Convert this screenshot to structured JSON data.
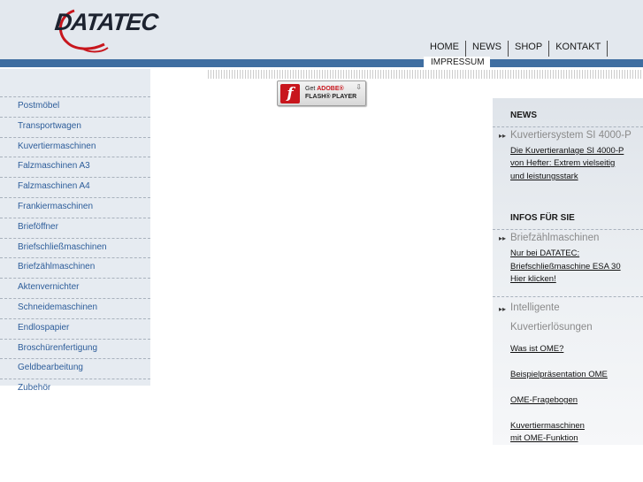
{
  "colors": {
    "accent_bar": "#3f6ea1",
    "header_bg": "#e3e8ee",
    "sidebar_bg": "#e6ebf1",
    "link": "#2d5d9a"
  },
  "logo": {
    "text": "DATATEC"
  },
  "topnav": {
    "items": [
      "HOME",
      "NEWS",
      "SHOP",
      "KONTAKT"
    ],
    "impressum": "IMPRESSUM"
  },
  "sidebar": {
    "items": [
      "Postmöbel",
      "Transportwagen",
      "Kuvertiermaschinen",
      "Falzmaschinen A3",
      "Falzmaschinen A4",
      "Frankiermaschinen",
      "Brieföffner",
      "Briefschließmaschinen",
      "Briefzählmaschinen",
      "Aktenvernichter",
      "Schneidemaschinen",
      "Endlospapier",
      "Broschürenfertigung",
      "Geldbearbeitung",
      "Zubehör"
    ]
  },
  "flash": {
    "get": "Get",
    "adobe": "ADOBE®",
    "product": "FLASH® PLAYER",
    "icon": "flash-logo-icon",
    "download_icon": "download-arrow-icon"
  },
  "right": {
    "news_heading": "NEWS",
    "news_sub": "Kuvertiersystem SI 4000-P",
    "news_link": [
      "Die Kuvertieranlage SI 4000-P",
      "von Hefter: Extrem vielseitig",
      "und leistungsstark"
    ],
    "infos_heading": "INFOS FÜR SIE",
    "infos_sub1": "Briefzählmaschinen",
    "infos_link1": [
      "Nur bei DATATEC:",
      "Briefschließmaschine ESA 30",
      "Hier klicken!"
    ],
    "infos_sub2": [
      "Intelligente",
      "Kuvertierlösungen"
    ],
    "ome_links": [
      "Was ist OME?",
      "Beispielpräsentation OME",
      "OME-Fragebogen"
    ],
    "ome_last": [
      "Kuvertiermaschinen",
      "mit OME-Funktion"
    ]
  }
}
